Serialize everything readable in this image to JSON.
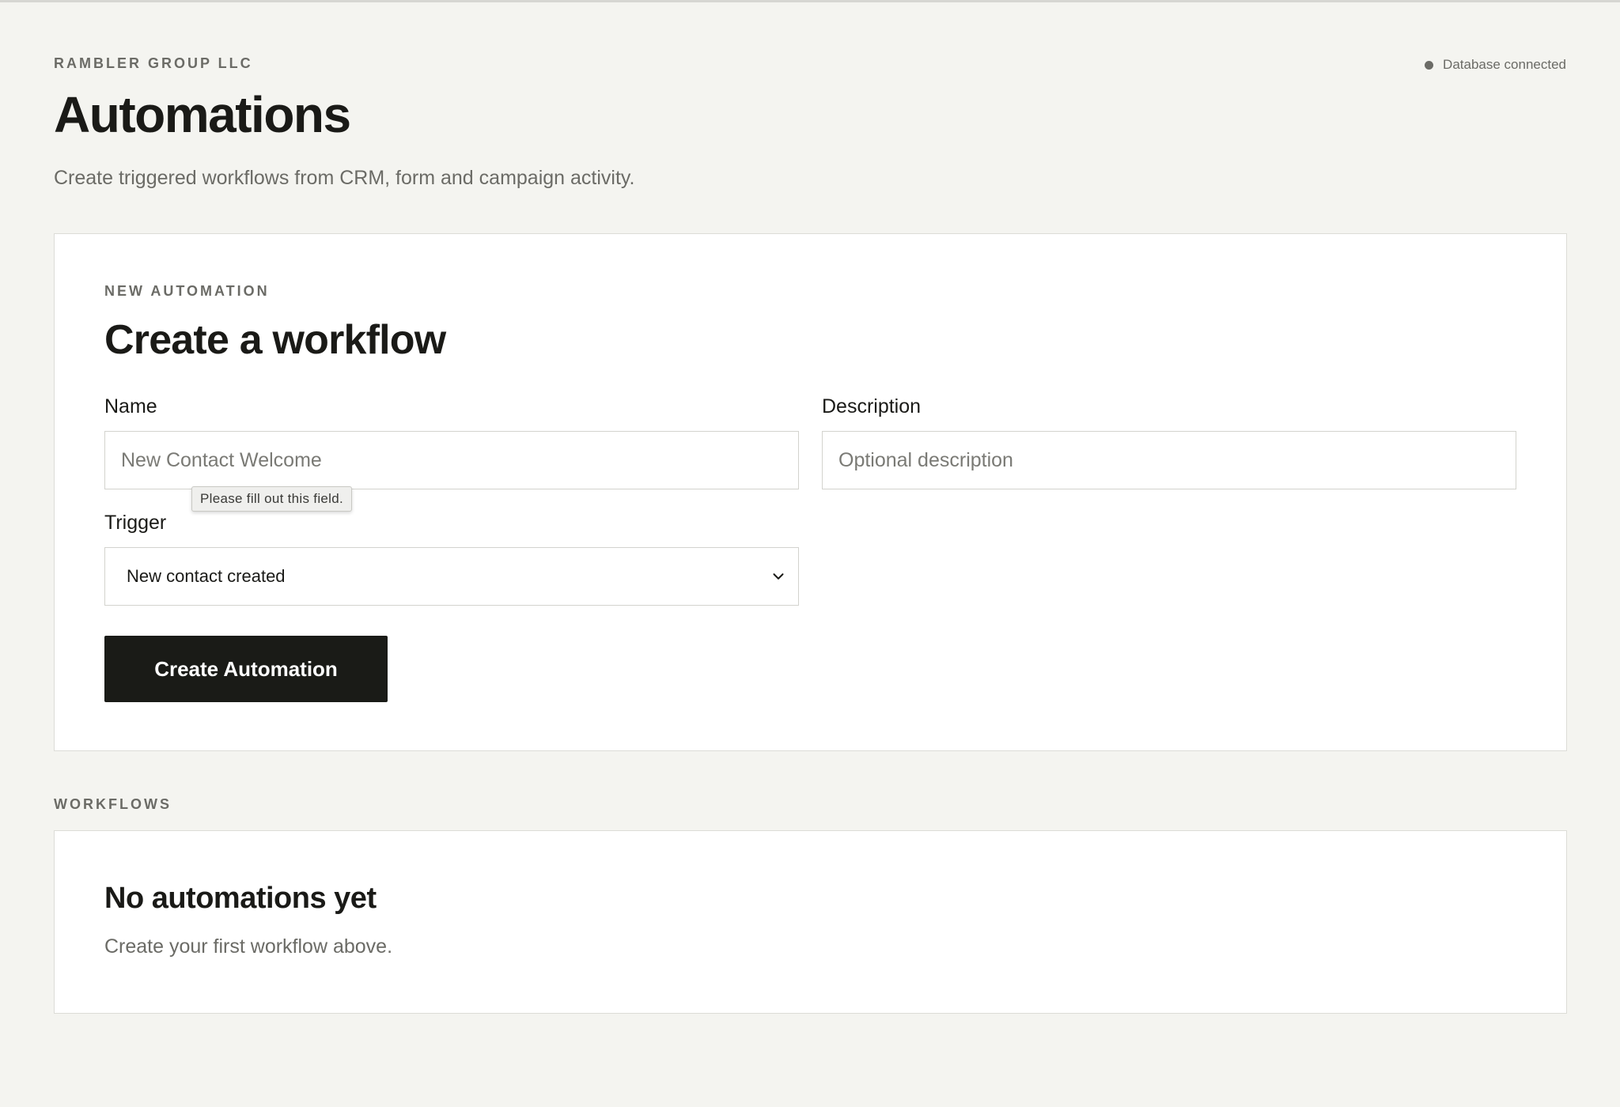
{
  "header": {
    "org_name": "RAMBLER GROUP LLC",
    "title": "Automations",
    "subtitle": "Create triggered workflows from CRM, form and campaign activity.",
    "status_text": "Database connected"
  },
  "new_automation": {
    "eyebrow": "NEW AUTOMATION",
    "title": "Create a workflow",
    "name_label": "Name",
    "name_placeholder": "New Contact Welcome",
    "name_value": "",
    "description_label": "Description",
    "description_placeholder": "Optional description",
    "description_value": "",
    "trigger_label": "Trigger",
    "trigger_selected": "New contact created",
    "validation_tooltip": "Please fill out this field.",
    "submit_label": "Create Automation"
  },
  "workflows": {
    "section_label": "WORKFLOWS",
    "empty_title": "No automations yet",
    "empty_text": "Create your first workflow above."
  },
  "icons": {
    "status": "status-dot-icon",
    "select": "chevron-down-icon"
  },
  "colors": {
    "background": "#f4f4f0",
    "card": "#ffffff",
    "primary_button": "#1a1b17",
    "muted_text": "#6b6b66"
  }
}
